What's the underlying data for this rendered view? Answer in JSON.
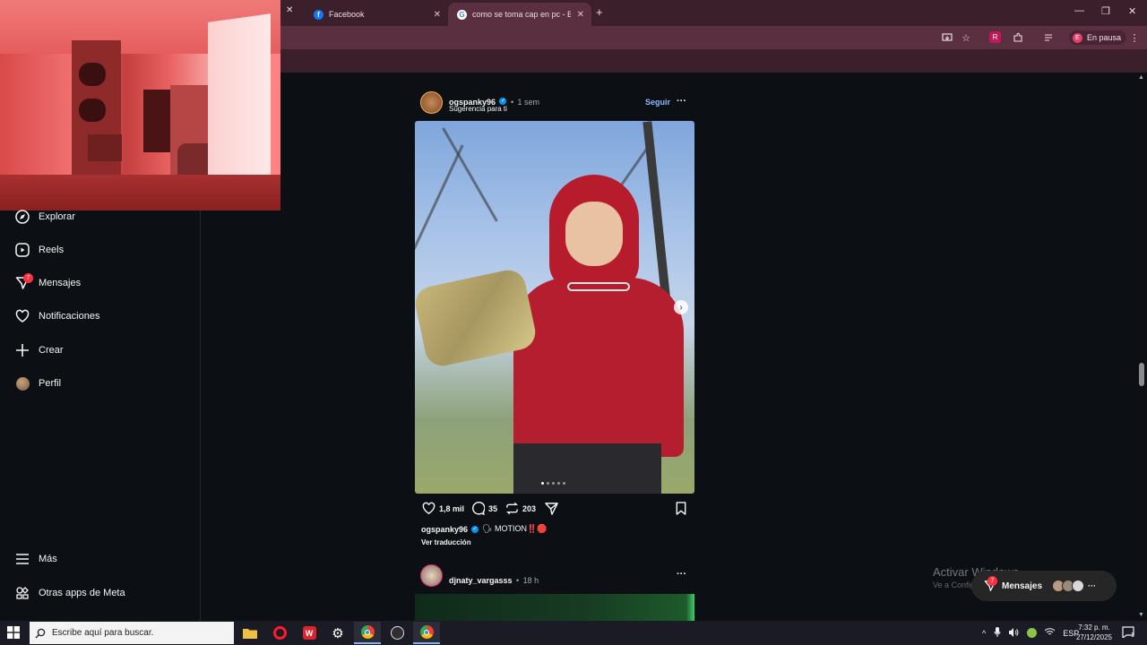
{
  "browser": {
    "tabs": [
      {
        "title": "Facebook",
        "icon": "facebook-icon"
      },
      {
        "title": "como se toma cap en pc - Busc",
        "icon": "google-icon"
      }
    ],
    "new_tab_label": "+",
    "profile_status": "En pausa",
    "profile_initial": "E"
  },
  "sidebar": {
    "items": [
      {
        "label": "Explorar",
        "icon": "compass-icon"
      },
      {
        "label": "Reels",
        "icon": "reels-icon"
      },
      {
        "label": "Mensajes",
        "icon": "messenger-icon",
        "badge": "7"
      },
      {
        "label": "Notificaciones",
        "icon": "heart-icon"
      },
      {
        "label": "Crear",
        "icon": "plus-icon"
      },
      {
        "label": "Perfil",
        "icon": "avatar"
      }
    ],
    "bottom_items": [
      {
        "label": "Más",
        "icon": "menu-icon"
      },
      {
        "label": "Otras apps de Meta",
        "icon": "meta-apps-icon"
      }
    ]
  },
  "post": {
    "username": "ogspanky96",
    "separator": "•",
    "time": "1 sem",
    "subtitle": "Sugerencia para ti",
    "follow_label": "Seguir",
    "more_label": "···",
    "likes": "1,8 mil",
    "comments": "35",
    "reposts": "203",
    "caption_user": "ogspanky96",
    "caption_text": "🗣 MOTION‼️🛑",
    "translate_label": "Ver traducción",
    "carousel_pages": 5,
    "carousel_active": 1
  },
  "next_post": {
    "username": "djnaty_vargasss",
    "separator": "•",
    "time": "18 h",
    "more_label": "···"
  },
  "messages_pill": {
    "label": "Mensajes",
    "badge": "7"
  },
  "watermark": {
    "title": "Activar Windows",
    "subtitle": "Ve a Configuración para activar Windows."
  },
  "taskbar": {
    "search_placeholder": "Escribe aquí para buscar.",
    "language": "ESP",
    "time": "7:32 p. m.",
    "date": "27/12/2025",
    "notification_count": "1"
  },
  "colors": {
    "background": "#0c1014",
    "accent": "#0095f6",
    "badge": "#ff3040",
    "chrome_frame": "#3b1f2b"
  }
}
